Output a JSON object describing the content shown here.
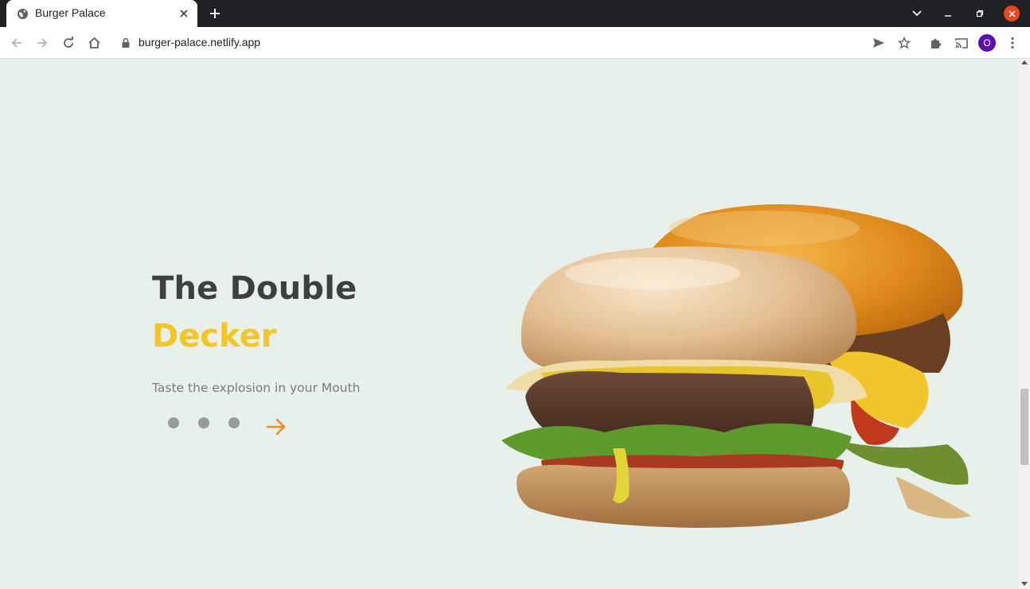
{
  "browser": {
    "tab": {
      "title": "Burger Palace",
      "favicon": "globe-icon",
      "close_icon": "close-icon"
    },
    "new_tab_icon": "plus-icon",
    "window_controls": [
      "chevron-down-icon",
      "minimize-icon",
      "restore-icon",
      "close-icon"
    ],
    "toolbar": {
      "back_icon": "arrow-left-icon",
      "forward_icon": "arrow-right-icon",
      "reload_icon": "reload-icon",
      "home_icon": "home-icon",
      "url": "burger-palace.netlify.app",
      "send_icon": "send-icon",
      "bookmark_icon": "star-icon",
      "extensions_icon": "puzzle-icon",
      "cast_icon": "cast-icon",
      "profile_initial": "O"
    }
  },
  "hero": {
    "title_line1": "The Double",
    "title_line2": "Decker",
    "subtitle": "Taste the explosion in your Mouth",
    "slides": {
      "count": 3,
      "icon": "dot-icon"
    },
    "next_icon": "arrow-right-icon",
    "image": "burger-image"
  },
  "colors": {
    "background": "#e8f0eb",
    "title": "#3f3f3f",
    "accent_yellow": "#f3c623",
    "accent_orange": "#f08a24",
    "subtitle": "#7a7a7a",
    "dot": "#9a9a9a"
  }
}
